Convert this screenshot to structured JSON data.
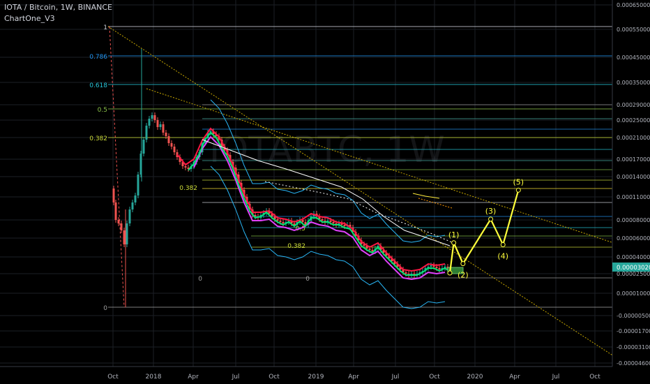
{
  "header": {
    "title": "IOTA / Bitcoin, 1W, BINANCE",
    "indicator": "ChartOne_V3",
    "watermark": "IOTABTC, 1W"
  },
  "colors": {
    "background": "#000000",
    "price_label_bg": "#26a69a",
    "elliott": "#ffff3b",
    "up": "#26a69a",
    "down": "#ef5350"
  },
  "chart_data": {
    "type": "line",
    "title": "IOTA / Bitcoin, 1W, BINANCE",
    "scale": "log",
    "grid": true,
    "x_ticks": [
      "Oct",
      "2018",
      "Apr",
      "Jul",
      "Oct",
      "2019",
      "Apr",
      "Jul",
      "Oct",
      "2020",
      "Apr",
      "Jul",
      "Oct"
    ],
    "y_ticks": [
      "0.00065000",
      "0.00055000",
      "0.00045000",
      "0.00035000",
      "0.00029000",
      "0.00025000",
      "0.00021000",
      "0.00017000",
      "0.00014000",
      "0.00011000",
      "0.00008000",
      "0.00006000",
      "0.00004000",
      "0.00002500",
      "0.00001000",
      "-0.00000500",
      "-0.00001700",
      "-0.00003100",
      "-0.00004600"
    ],
    "current_price": "0.00003020",
    "fib_labels": [
      "1",
      "0.786",
      "0.618",
      "0.5",
      "0.382",
      "0"
    ],
    "fib_inner_labels": [
      "0.382",
      "0.5",
      "0",
      "0",
      "0.382"
    ],
    "elliott_waves": [
      {
        "label": "(1)",
        "x": "2019-11-15",
        "y": 5.5e-05
      },
      {
        "label": "(2)",
        "x": "2019-12-06",
        "y": 3.4e-05
      },
      {
        "label": "(3)",
        "x": "2020-02-07",
        "y": 8.1e-05
      },
      {
        "label": "(4)",
        "x": "2020-03-06",
        "y": 5.3e-05
      },
      {
        "label": "(5)",
        "x": "2020-04-10",
        "y": 0.00012
      }
    ]
  }
}
